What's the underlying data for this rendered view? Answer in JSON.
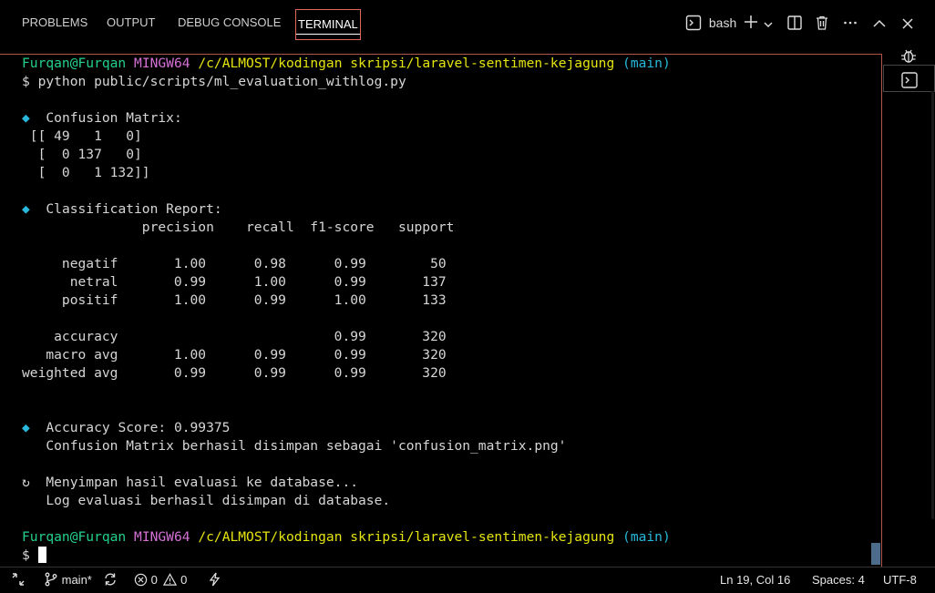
{
  "panel": {
    "tabs": [
      {
        "label": "PROBLEMS"
      },
      {
        "label": "OUTPUT"
      },
      {
        "label": "DEBUG CONSOLE"
      },
      {
        "label": "TERMINAL",
        "active": true
      }
    ],
    "shell_label": "bash",
    "icons": [
      "terminal-icon",
      "plus-icon",
      "chevron-down-icon",
      "split-icon",
      "trash-icon",
      "more-icon",
      "chevron-up-icon",
      "close-icon"
    ]
  },
  "terminal": {
    "prompt": {
      "user": "Furqan@Furqan",
      "system": "MINGW64",
      "path": "/c/ALMOST/kodingan skripsi/laravel-sentimen-kejagung",
      "branch": "(main)"
    },
    "command": "$ python public/scripts/ml_evaluation_withlog.py",
    "lines": [
      "",
      "◆  Confusion Matrix:",
      " [[ 49   1   0]",
      "  [  0 137   0]",
      "  [  0   1 132]]",
      "",
      "◆  Classification Report:",
      "               precision    recall  f1-score   support",
      "",
      "     negatif       1.00      0.98      0.99        50",
      "      netral       0.99      1.00      0.99       137",
      "     positif       1.00      0.99      1.00       133",
      "",
      "    accuracy                           0.99       320",
      "   macro avg       1.00      0.99      0.99       320",
      "weighted avg       0.99      0.99      0.99       320",
      "",
      "",
      "◆  Accuracy Score: 0.99375",
      "   Confusion Matrix berhasil disimpan sebagai 'confusion_matrix.png'",
      "",
      "↻  Menyimpan hasil evaluasi ke database...",
      "   Log evaluasi berhasil disimpan di database.",
      ""
    ],
    "final_prompt_symbol": "$"
  },
  "status_bar": {
    "branch": "main*",
    "errors": "0",
    "warnings": "0",
    "cursor_position": "Ln 19, Col 16",
    "spaces": "Spaces: 4",
    "encoding": "UTF-8"
  },
  "colors": {
    "prompt_user": "#23d18b",
    "prompt_system": "#d670d6",
    "prompt_path": "#e5e510",
    "prompt_branch": "#29b8db",
    "active_border": "#e06a5a"
  }
}
